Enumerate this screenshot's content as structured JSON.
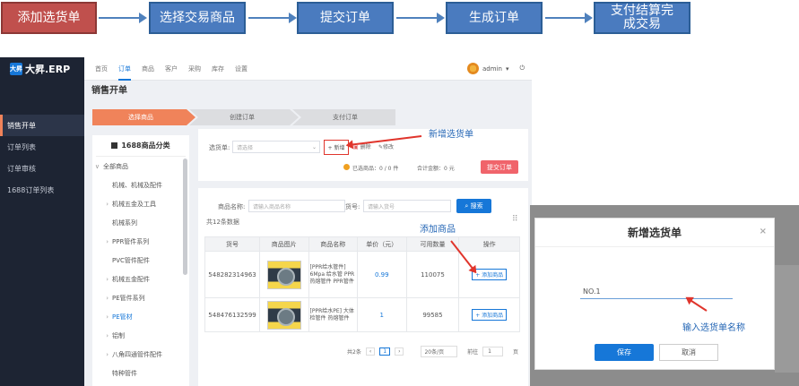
{
  "flow": [
    {
      "label": "添加选货单"
    },
    {
      "label": "选择交易商品"
    },
    {
      "label": "提交订单"
    },
    {
      "label": "生成订单"
    },
    {
      "label": "支付结算完成交易"
    }
  ],
  "app": {
    "logo": "大昇.ERP",
    "logo_mark": "大昇",
    "sidebar": [
      "销售开单",
      "订单列表",
      "订单审核",
      "1688订单列表"
    ],
    "topnav": [
      "首页",
      "订单",
      "商品",
      "客户",
      "采购",
      "库存",
      "设置"
    ],
    "user": "admin",
    "page_title": "销售开单",
    "steps": [
      "选择商品",
      "创建订单",
      "支付订单"
    ]
  },
  "tree": {
    "header": "1688商品分类",
    "items": [
      {
        "label": "全部商品",
        "prefix": "∨"
      },
      {
        "label": "机械、机械及配件",
        "prefix": ""
      },
      {
        "label": "机械五金及工具",
        "prefix": "›"
      },
      {
        "label": "机械系列",
        "prefix": ""
      },
      {
        "label": "PPR管件系列",
        "prefix": "›"
      },
      {
        "label": "PVC管件配件",
        "prefix": ""
      },
      {
        "label": "机械五金配件",
        "prefix": "›"
      },
      {
        "label": "PE管件系列",
        "prefix": "›"
      },
      {
        "label": "PE管材",
        "prefix": "›"
      },
      {
        "label": "铝制",
        "prefix": "›"
      },
      {
        "label": "八角四通管件配件",
        "prefix": "›"
      },
      {
        "label": "特种管件",
        "prefix": ""
      }
    ]
  },
  "selector": {
    "label": "选货单:",
    "placeholder": "请选择",
    "new_btn": "+ 新增",
    "delete_btn": "删除",
    "edit_btn": "修改",
    "selected_text": "已选商品：0 / 0 件",
    "total_text": "合计金额：0 元",
    "submit_btn": "提交订单"
  },
  "search": {
    "name_label": "商品名称:",
    "name_placeholder": "请输入商品名称",
    "code_label": "货号:",
    "code_placeholder": "请输入货号",
    "search_btn": "搜索",
    "count_text": "共12条数据"
  },
  "table": {
    "headers": [
      "货号",
      "商品图片",
      "商品名称",
      "单价（元）",
      "可用数量",
      "操作"
    ],
    "rows": [
      {
        "sku": "548282314963",
        "name": "[PPR给水管件] 6Mpa 给水管 PPR热熔管件 PPR管件",
        "price": "0.99",
        "qty": "110075",
        "action": "+ 添加商品"
      },
      {
        "sku": "548476132599",
        "name": "[PPR给水PE] 大体检管件 热熔管件",
        "price": "1",
        "qty": "99585",
        "action": "+ 添加商品"
      }
    ],
    "pagination": {
      "total": "共2条",
      "page": "1",
      "per_page": "20条/页",
      "goto_label": "前往",
      "goto_page": "1",
      "suffix": "页"
    }
  },
  "annotations": {
    "new_order": "新增选货单",
    "add_goods": "添加商品",
    "input_name": "输入选货单名称"
  },
  "modal": {
    "title": "新增选货单",
    "input_value": "NO.1",
    "save_btn": "保存",
    "cancel_btn": "取消"
  },
  "colors": {
    "flow_first": "#c0504d",
    "flow": "#4a7bbf",
    "accent": "#1677d8",
    "step_active": "#f0835a",
    "danger": "#f0646b"
  }
}
